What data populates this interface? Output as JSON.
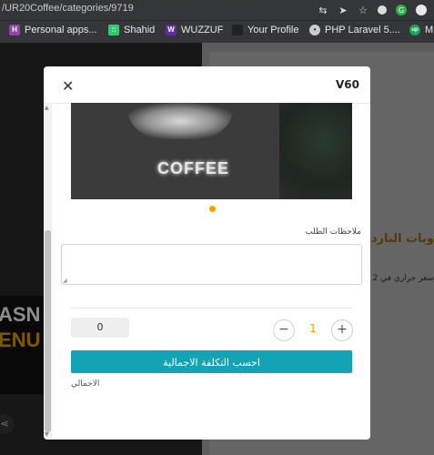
{
  "browser": {
    "url": "/UR20Coffee/categories/9719",
    "bookmarks": [
      {
        "label": "Personal apps...",
        "icon": "h-icon",
        "color": "#8e44ad",
        "glyph": "H"
      },
      {
        "label": "Shahid",
        "icon": "shahid-icon",
        "color": "#2ecc71",
        "glyph": "::"
      },
      {
        "label": "WUZZUF",
        "icon": "wuzzuf-icon",
        "color": "#5b2ca3",
        "glyph": "W"
      },
      {
        "label": "Your Profile",
        "icon": "profile-icon",
        "color": "#222222",
        "glyph": ""
      },
      {
        "label": "PHP Laravel 5....",
        "icon": "laravel-icon",
        "color": "#cccccc",
        "glyph": "•"
      },
      {
        "label": "M",
        "icon": "m-icon",
        "color": "#1aa35a",
        "glyph": "up"
      }
    ]
  },
  "background": {
    "heading": "وبات البارده",
    "subtext": "2 سعر حراري في"
  },
  "modal": {
    "title": "V60",
    "close_glyph": "✕",
    "image_text": "COFFEE",
    "notes_label": "ملاحظات الطلب",
    "notes_value": "",
    "total_value": "0",
    "quantity": "1",
    "minus_glyph": "−",
    "plus_glyph": "+",
    "calc_button": "احسب التكلفة الاجمالية",
    "total_label": "الاجمالي"
  },
  "colors": {
    "accent": "#12a3b4",
    "quantity": "#e9a400",
    "dot": "#f0a500"
  }
}
